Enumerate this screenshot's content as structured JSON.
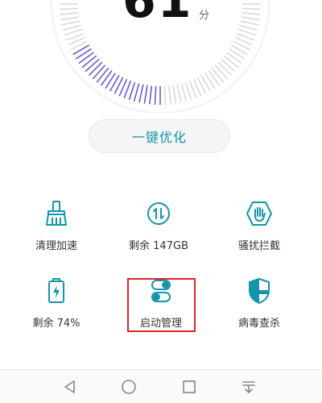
{
  "score": {
    "value": "61",
    "unit": "分"
  },
  "optimize": {
    "label": "一键优化"
  },
  "tools": [
    {
      "label": "清理加速",
      "icon": "broom-icon"
    },
    {
      "label": "剩余 147GB",
      "icon": "storage-transfer-icon"
    },
    {
      "label": "骚扰拦截",
      "icon": "hand-block-icon"
    },
    {
      "label": "剩余 74%",
      "icon": "battery-charging-icon"
    },
    {
      "label": "启动管理",
      "icon": "toggle-switch-icon"
    },
    {
      "label": "病毒查杀",
      "icon": "shield-icon"
    }
  ],
  "colors": {
    "accent": "#1496a8",
    "dial_active": "#6a5ccf",
    "dial_inactive": "#d9d9d9",
    "highlight": "#d8262a"
  },
  "navbar": {
    "icons": [
      "back-icon",
      "home-icon",
      "recents-icon",
      "notification-pull-icon"
    ]
  }
}
